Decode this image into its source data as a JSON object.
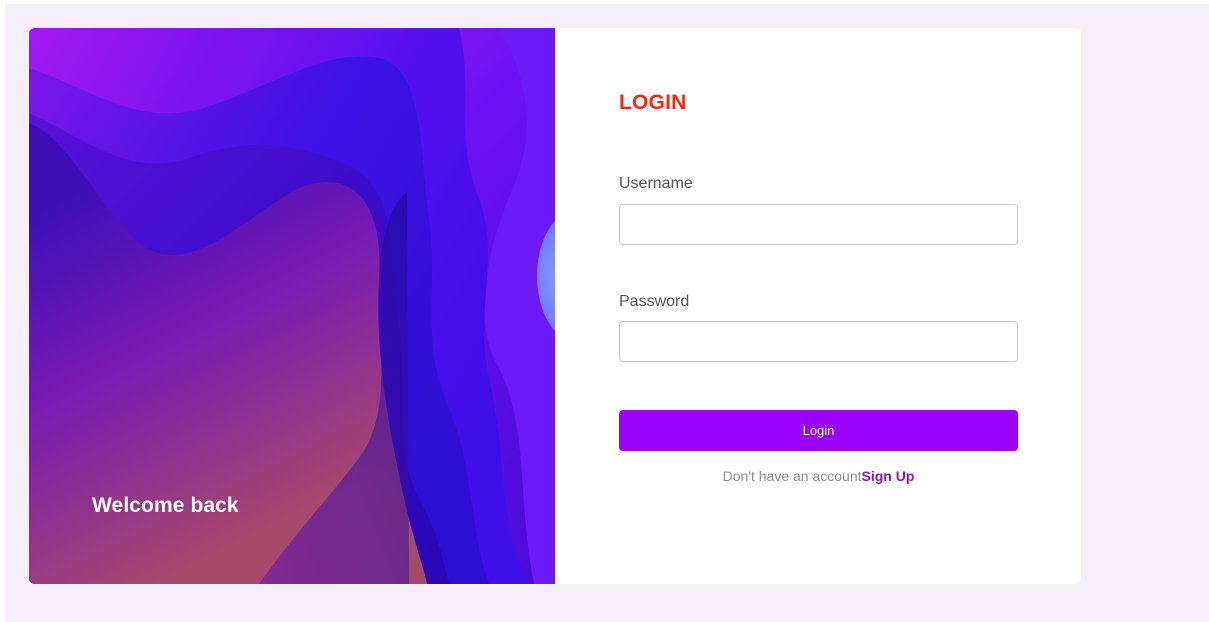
{
  "colors": {
    "page_background": "#f6effb",
    "card_background": "#ffffff",
    "title_color": "#ee2b14",
    "button_color": "#9b00fa",
    "signup_link_color": "#8a12d8"
  },
  "hero": {
    "welcome_text": "Welcome back",
    "artwork": "abstract-purple-waves"
  },
  "login_form": {
    "title": "LOGIN",
    "username_label": "Username",
    "username_value": "",
    "password_label": "Password",
    "password_value": "",
    "submit_label": "Login",
    "signup_prompt": "Don't have an account",
    "signup_link": "Sign Up"
  }
}
